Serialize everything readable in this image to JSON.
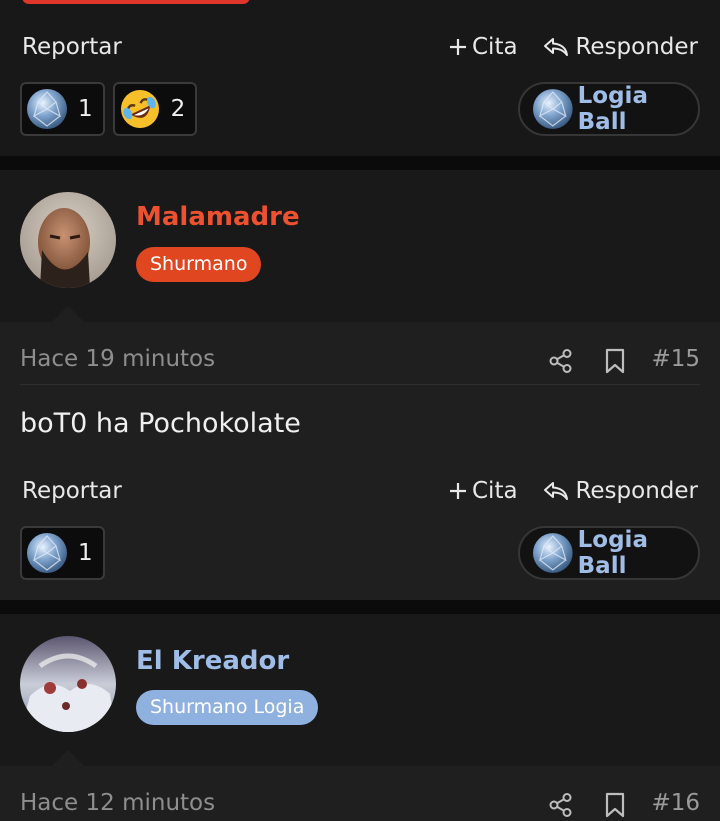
{
  "posts": [
    {
      "actions": {
        "report": "Reportar",
        "quote": "Cita",
        "reply": "Responder"
      },
      "reactions": [
        {
          "emoji": "logia-ball-icon",
          "count": "1"
        },
        {
          "emoji": "rofl-emoji-icon",
          "count": "2"
        }
      ],
      "react_label": "Logia Ball"
    },
    {
      "author": {
        "name": "Malamadre",
        "name_color": "#ee5130",
        "role": "Shurmano",
        "role_color": "#e0461f"
      },
      "time": "Hace 19 minutos",
      "number": "#15",
      "body": "boT0 ha Pochokolate",
      "actions": {
        "report": "Reportar",
        "quote": "Cita",
        "reply": "Responder"
      },
      "reactions": [
        {
          "emoji": "logia-ball-icon",
          "count": "1"
        }
      ],
      "react_label": "Logia Ball"
    },
    {
      "author": {
        "name": "El Kreador",
        "name_color": "#9fbde6",
        "role": "Shurmano Logia",
        "role_color": "#8fb1e0"
      },
      "time": "Hace 12 minutos",
      "number": "#16"
    }
  ]
}
